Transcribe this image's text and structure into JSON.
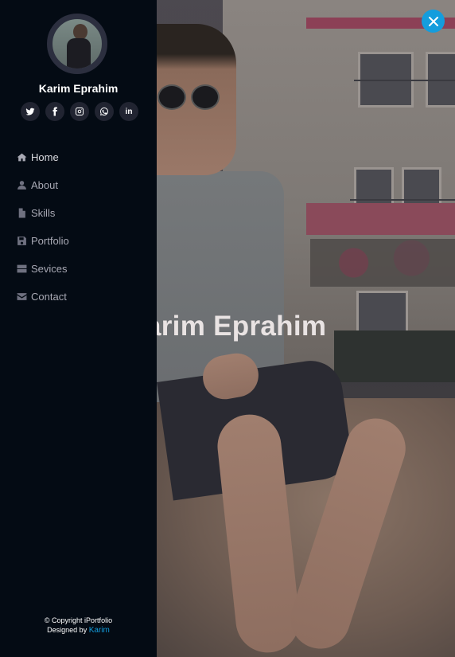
{
  "profile": {
    "name": "Karim Eprahim"
  },
  "social": [
    {
      "icon": "twitter-icon"
    },
    {
      "icon": "facebook-icon"
    },
    {
      "icon": "instagram-icon"
    },
    {
      "icon": "whatsapp-icon"
    },
    {
      "icon": "linkedin-icon",
      "text": "in"
    }
  ],
  "nav": {
    "items": [
      {
        "label": "Home",
        "icon": "home-icon"
      },
      {
        "label": "About",
        "icon": "user-icon"
      },
      {
        "label": "Skills",
        "icon": "file-icon"
      },
      {
        "label": "Portfolio",
        "icon": "floppy-disk-icon"
      },
      {
        "label": "Sevices",
        "icon": "server-icon"
      },
      {
        "label": "Contact",
        "icon": "envelope-icon"
      }
    ]
  },
  "hero": {
    "title": "arim Eprahim"
  },
  "footer": {
    "copyright": "© Copyright iPortfolio",
    "designed_by": "Designed by",
    "designer": "Karim"
  },
  "colors": {
    "accent": "#149ddd",
    "sidebar_bg": "#040b14",
    "social_bg": "#212431",
    "nav_text": "#a8a9b4"
  }
}
